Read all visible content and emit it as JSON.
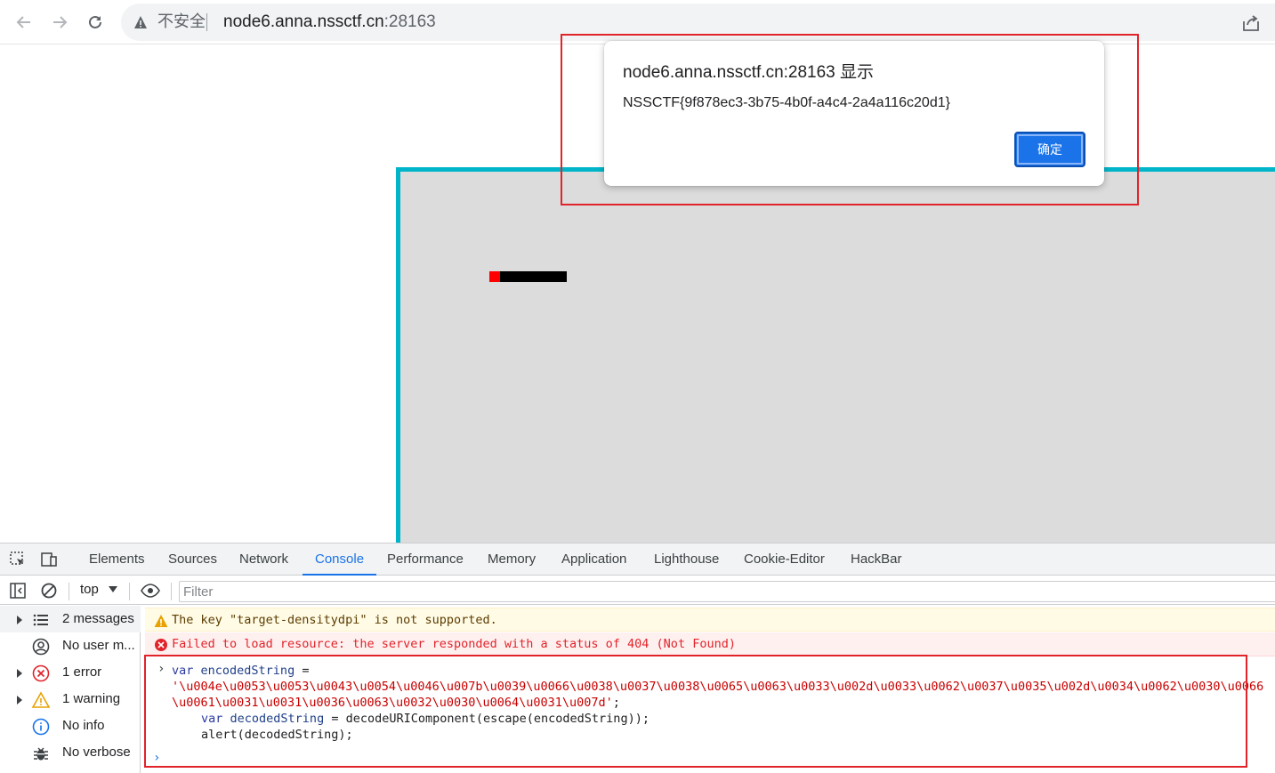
{
  "browser": {
    "security_label": "不安全",
    "url_host": "node6.anna.nssctf.cn",
    "url_port": ":28163"
  },
  "dialog": {
    "title": "node6.anna.nssctf.cn:28163 显示",
    "message": "NSSCTF{9f878ec3-3b75-4b0f-a4c4-2a4a116c20d1}",
    "ok_label": "确定"
  },
  "devtools": {
    "tabs": [
      "Elements",
      "Sources",
      "Network",
      "Console",
      "Performance",
      "Memory",
      "Application",
      "Lighthouse",
      "Cookie-Editor",
      "HackBar"
    ],
    "active_tab": "Console",
    "context": "top",
    "filter_placeholder": "Filter",
    "sidebar": [
      {
        "label": "2 messages",
        "icon": "list-icon",
        "expandable": true
      },
      {
        "label": "No user m...",
        "icon": "user-icon",
        "expandable": false
      },
      {
        "label": "1 error",
        "icon": "error-icon",
        "expandable": true
      },
      {
        "label": "1 warning",
        "icon": "warning-icon",
        "expandable": true
      },
      {
        "label": "No info",
        "icon": "info-icon",
        "expandable": false
      },
      {
        "label": "No verbose",
        "icon": "bug-icon",
        "expandable": false
      }
    ],
    "messages": {
      "warning": "The key \"target-densitydpi\" is not supported.",
      "error": "Failed to load resource: the server responded with a status of 404 (Not Found)"
    },
    "code": {
      "line1_kw": "var",
      "line1_ident": "encodedString",
      "line1_op": " =",
      "line2": "'\\u004e\\u0053\\u0053\\u0043\\u0054\\u0046\\u007b\\u0039\\u0066\\u0038\\u0037\\u0038\\u0065\\u0063\\u0033\\u002d\\u0033\\u0062\\u0037\\u0035\\u002d\\u0034\\u0062\\u0030\\u0066",
      "line3": "\\u0061\\u0031\\u0031\\u0036\\u0063\\u0032\\u0030\\u0064\\u0031\\u007d'",
      "line3_end": ";",
      "line4_kw": "var",
      "line4_ident": "decodedString",
      "line4_rest": " = decodeURIComponent(escape(encodedString));",
      "line5": "alert(decodedString);"
    }
  },
  "colors": {
    "accent": "#1a73e8",
    "game_border": "#00b5c9",
    "highlight": "#e0242a",
    "snake_head": "#ff0000"
  }
}
